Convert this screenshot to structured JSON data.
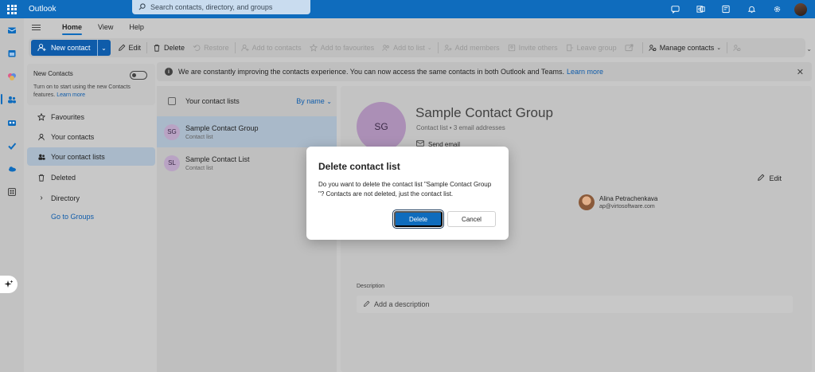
{
  "titlebar": {
    "app_name": "Outlook",
    "search_placeholder": "Search contacts, directory, and groups"
  },
  "ribbon": {
    "tabs": [
      "Home",
      "View",
      "Help"
    ],
    "active_tab": "Home",
    "buttons": {
      "new_contact": "New contact",
      "edit": "Edit",
      "delete": "Delete",
      "restore": "Restore",
      "add_to_contacts": "Add to contacts",
      "add_to_favourites": "Add to favourites",
      "add_to_list": "Add to list",
      "add_members": "Add members",
      "invite_others": "Invite others",
      "leave_group": "Leave group",
      "manage_contacts": "Manage contacts"
    }
  },
  "folders": {
    "new_contacts": {
      "title": "New Contacts",
      "description": "Turn on to start using the new Contacts features.",
      "link": "Learn more",
      "enabled": false
    },
    "items": [
      {
        "label": "Favourites",
        "icon": "star-icon"
      },
      {
        "label": "Your contacts",
        "icon": "person-icon"
      },
      {
        "label": "Your contact lists",
        "icon": "people-icon"
      },
      {
        "label": "Deleted",
        "icon": "trash-icon"
      },
      {
        "label": "Directory",
        "icon": "chevron-right-icon"
      }
    ],
    "selected": "Your contact lists",
    "goto_groups": "Go to Groups"
  },
  "notice": {
    "text": "We are constantly improving the contacts experience. You can now access the same contacts in both Outlook and Teams.",
    "link": "Learn more"
  },
  "list": {
    "title": "Your contact lists",
    "sort": "By name",
    "items": [
      {
        "initials": "SG",
        "name": "Sample Contact Group",
        "subtitle": "Contact list"
      },
      {
        "initials": "SL",
        "name": "Sample Contact List",
        "subtitle": "Contact list"
      }
    ]
  },
  "detail": {
    "initials": "SG",
    "name": "Sample Contact Group",
    "subtitle": "Contact list • 3 email addresses",
    "send_email": "Send email",
    "edit": "Edit",
    "member": {
      "name": "Alina Petrachenkava",
      "email": "ap@virtosoftware.com"
    },
    "description_label": "Description",
    "description_placeholder": "Add a description"
  },
  "dialog": {
    "title": "Delete contact list",
    "body": "Do you want to delete the contact list \"Sample Contact Group \"? Contacts are not deleted, just the contact list.",
    "confirm": "Delete",
    "cancel": "Cancel"
  },
  "colors": {
    "brand": "#0f6cbd",
    "selected_bg": "#a9b9c9",
    "link": "#0f5caa"
  }
}
